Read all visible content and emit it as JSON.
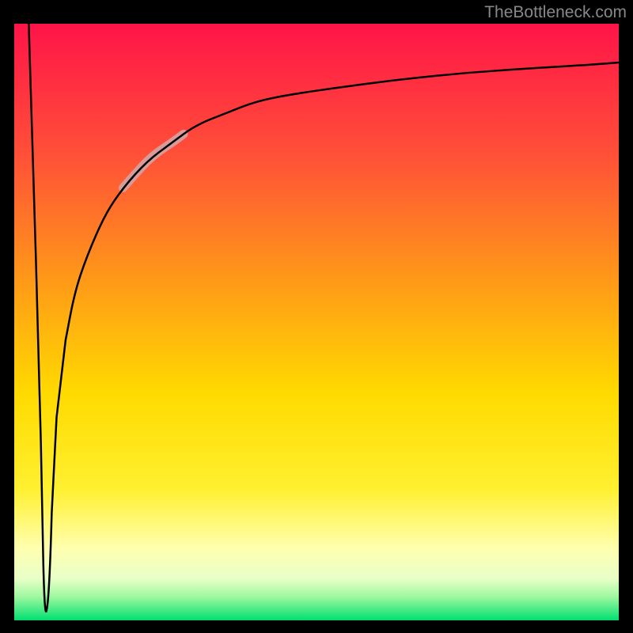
{
  "watermark": "TheBottleneck.com",
  "chart_data": {
    "type": "line",
    "title": "",
    "xlabel": "",
    "ylabel": "",
    "xlim": [
      0,
      100
    ],
    "ylim": [
      0,
      100
    ],
    "gradient_colors": {
      "top": "#FF1448",
      "upper": "#FF7030",
      "mid_upper": "#FFBF00",
      "mid_lower": "#FFE030",
      "lower": "#FFFFB0",
      "pale": "#F0FFD0",
      "bottom": "#00DF70"
    },
    "curve": {
      "description": "Sharp dip from top-left to near bottom then asymptotic rise toward top-right",
      "dip_x": 5,
      "dip_y": 2,
      "asymptote_y": 94,
      "points": [
        {
          "x": 2.5,
          "y": 100
        },
        {
          "x": 4.0,
          "y": 50
        },
        {
          "x": 5.0,
          "y": 2
        },
        {
          "x": 6.0,
          "y": 20
        },
        {
          "x": 7.5,
          "y": 40
        },
        {
          "x": 10,
          "y": 55
        },
        {
          "x": 15,
          "y": 68
        },
        {
          "x": 20,
          "y": 75
        },
        {
          "x": 30,
          "y": 83
        },
        {
          "x": 40,
          "y": 87
        },
        {
          "x": 50,
          "y": 89
        },
        {
          "x": 60,
          "y": 90.5
        },
        {
          "x": 70,
          "y": 91.5
        },
        {
          "x": 80,
          "y": 92.3
        },
        {
          "x": 90,
          "y": 93
        },
        {
          "x": 100,
          "y": 93.5
        }
      ]
    },
    "highlight_segment": {
      "color": "#D99A9A",
      "x_range": [
        18,
        28
      ],
      "y_range": [
        72,
        82
      ]
    }
  }
}
